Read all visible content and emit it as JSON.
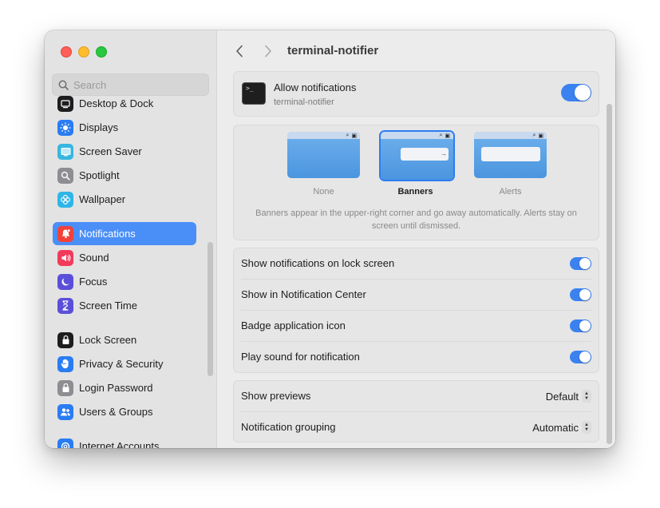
{
  "window": {
    "title": "terminal-notifier"
  },
  "sidebar": {
    "search_placeholder": "Search",
    "items": [
      {
        "label": "Desktop & Dock",
        "icon": "desktop-dock-icon",
        "color": "#1d1d1f"
      },
      {
        "label": "Displays",
        "icon": "displays-icon",
        "color": "#2a7cf3"
      },
      {
        "label": "Screen Saver",
        "icon": "screen-saver-icon",
        "color": "#37b6e0"
      },
      {
        "label": "Spotlight",
        "icon": "spotlight-icon",
        "color": "#8d8d92"
      },
      {
        "label": "Wallpaper",
        "icon": "wallpaper-icon",
        "color": "#2fb5e8"
      },
      {
        "label": "Notifications",
        "icon": "notifications-icon",
        "color": "#f2413a"
      },
      {
        "label": "Sound",
        "icon": "sound-icon",
        "color": "#f23a5a"
      },
      {
        "label": "Focus",
        "icon": "focus-icon",
        "color": "#5b4fd9"
      },
      {
        "label": "Screen Time",
        "icon": "screen-time-icon",
        "color": "#5b4fd9"
      },
      {
        "label": "Lock Screen",
        "icon": "lock-screen-icon",
        "color": "#1d1d1f"
      },
      {
        "label": "Privacy & Security",
        "icon": "privacy-hand-icon",
        "color": "#2a7cf3"
      },
      {
        "label": "Login Password",
        "icon": "login-password-icon",
        "color": "#8d8d92"
      },
      {
        "label": "Users & Groups",
        "icon": "users-groups-icon",
        "color": "#2a7cf3"
      },
      {
        "label": "Internet Accounts",
        "icon": "internet-accounts-icon",
        "color": "#2a7cf3"
      }
    ],
    "selected": "Notifications"
  },
  "main": {
    "allow": {
      "title": "Allow notifications",
      "subtitle": "terminal-notifier",
      "enabled": true
    },
    "alert_style": {
      "options": [
        "None",
        "Banners",
        "Alerts"
      ],
      "selected": "Banners",
      "description": "Banners appear in the upper-right corner and go away automatically. Alerts stay on screen until dismissed."
    },
    "toggles": [
      {
        "label": "Show notifications on lock screen",
        "on": true
      },
      {
        "label": "Show in Notification Center",
        "on": true
      },
      {
        "label": "Badge application icon",
        "on": true
      },
      {
        "label": "Play sound for notification",
        "on": true
      }
    ],
    "popups": [
      {
        "label": "Show previews",
        "value": "Default"
      },
      {
        "label": "Notification grouping",
        "value": "Automatic"
      }
    ]
  },
  "colors": {
    "accent": "#3b82f0",
    "selection": "#4a8ef7"
  }
}
